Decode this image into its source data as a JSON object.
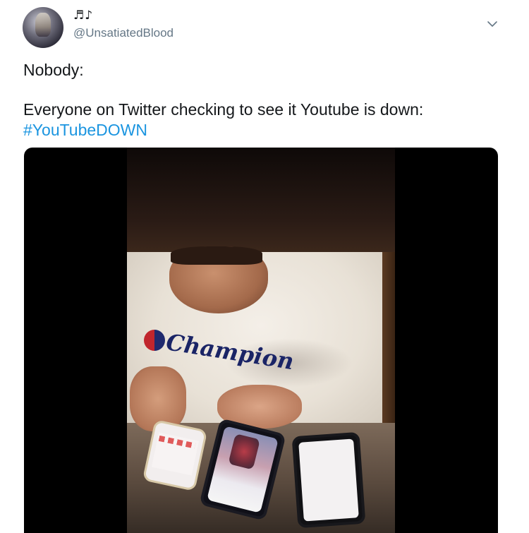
{
  "tweet": {
    "display_name": "♬♪",
    "handle": "@UnsatiatedBlood",
    "text_line1": "Nobody:",
    "text_line2": "Everyone on Twitter checking to see it Youtube is down:",
    "hashtag": "#YouTubeDOWN",
    "icons": {
      "avatar": "user-avatar",
      "menu": "chevron-down-icon"
    },
    "colors": {
      "link": "#1b95e0",
      "handle": "#657786",
      "text": "#14171a"
    }
  },
  "media": {
    "type": "video",
    "sweatshirt_logo_text": "Champion"
  }
}
